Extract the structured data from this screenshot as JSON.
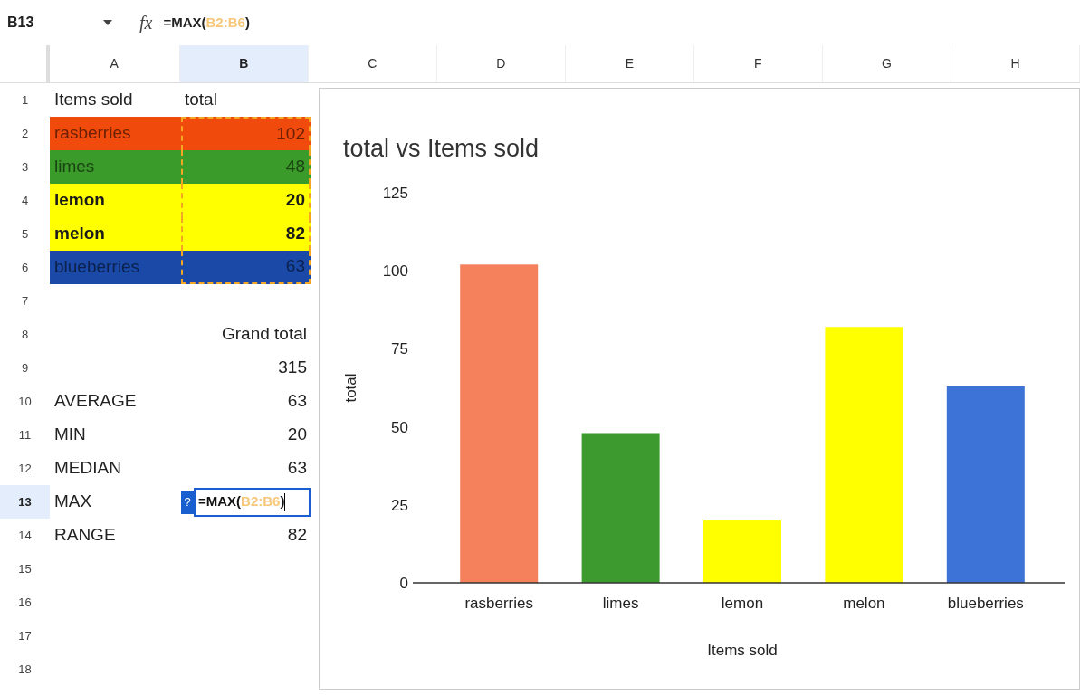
{
  "formula_bar": {
    "cell": "B13",
    "function_label": "fx",
    "formula_prefix": "=MAX(",
    "formula_range": "B2:B6",
    "formula_suffix": ")"
  },
  "columns": [
    {
      "label": "A",
      "selected": false
    },
    {
      "label": "B",
      "selected": true
    },
    {
      "label": "C",
      "selected": false
    },
    {
      "label": "D",
      "selected": false
    },
    {
      "label": "E",
      "selected": false
    },
    {
      "label": "F",
      "selected": false
    },
    {
      "label": "G",
      "selected": false
    },
    {
      "label": "H",
      "selected": false
    }
  ],
  "rows": [
    {
      "number": "1",
      "selected": false,
      "kind": "plain",
      "a": "Items sold",
      "b": "total"
    },
    {
      "number": "2",
      "selected": false,
      "kind": "filled",
      "color": "#f04a0c",
      "marked": true,
      "a": "rasberries",
      "b": "102"
    },
    {
      "number": "3",
      "selected": false,
      "kind": "filled",
      "color": "#3a9a2a",
      "marked": true,
      "a": "limes",
      "b": "48"
    },
    {
      "number": "4",
      "selected": false,
      "kind": "filled",
      "color": "#ffff00",
      "marked": true,
      "a": "lemon",
      "b": "20"
    },
    {
      "number": "5",
      "selected": false,
      "kind": "filled",
      "color": "#ffff00",
      "marked": true,
      "a": "melon",
      "b": "82"
    },
    {
      "number": "6",
      "selected": false,
      "kind": "filled",
      "color": "#1a49a8",
      "marked": true,
      "a": "blueberries",
      "b": "63"
    },
    {
      "number": "7",
      "selected": false,
      "kind": "plain"
    },
    {
      "number": "8",
      "selected": false,
      "kind": "plain",
      "b": "Grand total"
    },
    {
      "number": "9",
      "selected": false,
      "kind": "plain",
      "b": "315"
    },
    {
      "number": "10",
      "selected": false,
      "kind": "plain",
      "a": "AVERAGE",
      "b": "63"
    },
    {
      "number": "11",
      "selected": false,
      "kind": "plain",
      "a": "MIN",
      "b": "20"
    },
    {
      "number": "12",
      "selected": false,
      "kind": "plain",
      "a": "MEDIAN",
      "b": "63"
    },
    {
      "number": "13",
      "selected": true,
      "kind": "editing",
      "a": "MAX",
      "help": "?",
      "formula_prefix": "=MAX(",
      "formula_range": "B2:B6",
      "formula_suffix": ")"
    },
    {
      "number": "14",
      "selected": false,
      "kind": "plain",
      "a": "RANGE",
      "b": "82"
    },
    {
      "number": "15",
      "selected": false,
      "kind": "plain"
    },
    {
      "number": "16",
      "selected": false,
      "kind": "plain"
    },
    {
      "number": "17",
      "selected": false,
      "kind": "plain"
    },
    {
      "number": "18",
      "selected": false,
      "kind": "plain"
    }
  ],
  "chart": {
    "chart_data": {
      "type": "bar",
      "title": "total vs Items sold",
      "xlabel": "Items sold",
      "ylabel": "total",
      "categories": [
        "rasberries",
        "limes",
        "lemon",
        "melon",
        "blueberries"
      ],
      "series": [
        {
          "color": "#f4805c",
          "values": [
            102,
            null,
            null,
            null,
            null
          ]
        },
        {
          "color": "#3c9a2f",
          "values": [
            null,
            48,
            null,
            null,
            null
          ]
        },
        {
          "color": "#ffff00",
          "values": [
            null,
            null,
            20,
            null,
            null
          ]
        },
        {
          "color": "#ffff00",
          "values": [
            null,
            null,
            null,
            82,
            null
          ]
        },
        {
          "color": "#3d73d6",
          "values": [
            null,
            null,
            null,
            null,
            63
          ]
        }
      ],
      "stacked": true,
      "ylim": [
        0,
        125
      ],
      "yticks": [
        0,
        25,
        50,
        75,
        100,
        125
      ]
    }
  }
}
